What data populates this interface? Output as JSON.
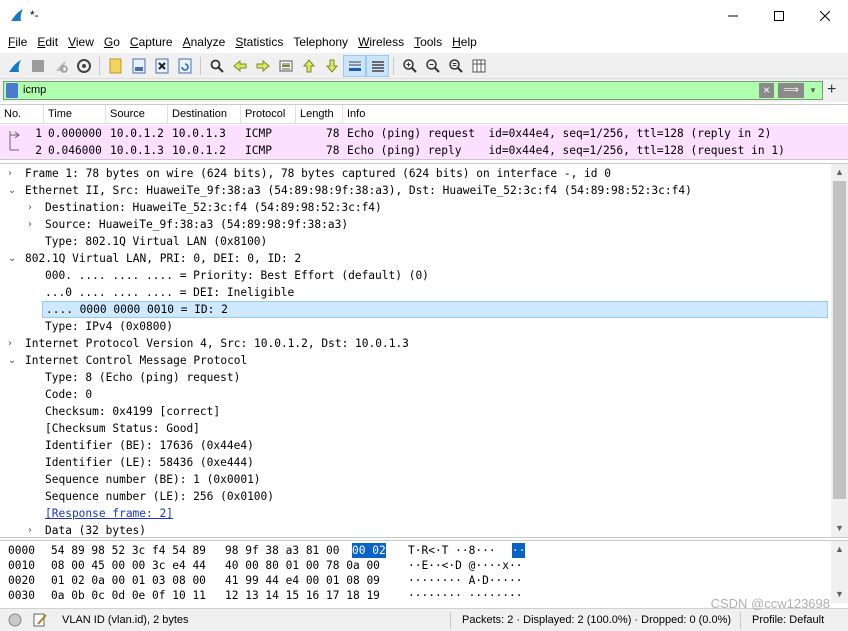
{
  "window": {
    "title": "*-",
    "minimize_glyph": "—",
    "maximize_glyph": "☐",
    "close_glyph": "✕"
  },
  "menu": {
    "items": [
      {
        "first": "F",
        "rest": "ile"
      },
      {
        "first": "E",
        "rest": "dit"
      },
      {
        "first": "V",
        "rest": "iew"
      },
      {
        "first": "G",
        "rest": "o"
      },
      {
        "first": "C",
        "rest": "apture"
      },
      {
        "first": "A",
        "rest": "nalyze"
      },
      {
        "first": "S",
        "rest": "tatistics"
      },
      {
        "first": "",
        "rest": "Telephony"
      },
      {
        "first": "W",
        "rest": "ireless"
      },
      {
        "first": "T",
        "rest": "ools"
      },
      {
        "first": "H",
        "rest": "elp"
      }
    ]
  },
  "toolbar": {
    "icons": [
      "shark-fin-start-icon",
      "stop-icon",
      "restart-icon",
      "options-gear-icon",
      "open-file-icon",
      "save-file-icon",
      "close-file-icon",
      "reload-icon",
      "find-icon",
      "go-back-icon",
      "go-forward-icon",
      "go-to-packet-icon",
      "go-first-icon",
      "go-last-icon",
      "autoscroll-icon",
      "colorize-icon",
      "zoom-in-icon",
      "zoom-out-icon",
      "zoom-normal-icon",
      "resize-columns-icon"
    ]
  },
  "filter": {
    "value": "icmp",
    "apply_glyph": "⟹",
    "dropdown_glyph": "▾",
    "add_glyph": "+"
  },
  "packet_list": {
    "columns": [
      "No.",
      "Time",
      "Source",
      "Destination",
      "Protocol",
      "Length",
      "Info"
    ],
    "rows": [
      {
        "no": "1",
        "time": "0.000000",
        "src": "10.0.1.2",
        "dst": "10.0.1.3",
        "proto": "ICMP",
        "len": "78",
        "info": "Echo (ping) request  id=0x44e4, seq=1/256, ttl=128 (reply in 2)"
      },
      {
        "no": "2",
        "time": "0.046000",
        "src": "10.0.1.3",
        "dst": "10.0.1.2",
        "proto": "ICMP",
        "len": "78",
        "info": "Echo (ping) reply    id=0x44e4, seq=1/256, ttl=128 (request in 1)"
      }
    ],
    "row_bg": "#fce0ff"
  },
  "details": {
    "lines": [
      {
        "arrow": "›",
        "text": "Frame 1: 78 bytes on wire (624 bits), 78 bytes captured (624 bits) on interface -, id 0"
      },
      {
        "arrow": "⌄",
        "text": "Ethernet II, Src: HuaweiTe_9f:38:a3 (54:89:98:9f:38:a3), Dst: HuaweiTe_52:3c:f4 (54:89:98:52:3c:f4)"
      },
      {
        "arrow": "›",
        "text": "Destination: HuaweiTe_52:3c:f4 (54:89:98:52:3c:f4)"
      },
      {
        "arrow": "›",
        "text": "Source: HuaweiTe_9f:38:a3 (54:89:98:9f:38:a3)"
      },
      {
        "arrow": "",
        "text": "Type: 802.1Q Virtual LAN (0x8100)"
      },
      {
        "arrow": "⌄",
        "text": "802.1Q Virtual LAN, PRI: 0, DEI: 0, ID: 2"
      },
      {
        "arrow": "",
        "text": "000. .... .... .... = Priority: Best Effort (default) (0)"
      },
      {
        "arrow": "",
        "text": "...0 .... .... .... = DEI: Ineligible"
      },
      {
        "arrow": "",
        "text": ".... 0000 0000 0010 = ID: 2"
      },
      {
        "arrow": "",
        "text": "Type: IPv4 (0x0800)"
      },
      {
        "arrow": "›",
        "text": "Internet Protocol Version 4, Src: 10.0.1.2, Dst: 10.0.1.3"
      },
      {
        "arrow": "⌄",
        "text": "Internet Control Message Protocol"
      },
      {
        "arrow": "",
        "text": "Type: 8 (Echo (ping) request)"
      },
      {
        "arrow": "",
        "text": "Code: 0"
      },
      {
        "arrow": "",
        "text": "Checksum: 0x4199 [correct]"
      },
      {
        "arrow": "",
        "text": "[Checksum Status: Good]"
      },
      {
        "arrow": "",
        "text": "Identifier (BE): 17636 (0x44e4)"
      },
      {
        "arrow": "",
        "text": "Identifier (LE): 58436 (0xe444)"
      },
      {
        "arrow": "",
        "text": "Sequence number (BE): 1 (0x0001)"
      },
      {
        "arrow": "",
        "text": "Sequence number (LE): 256 (0x0100)"
      },
      {
        "arrow": "",
        "text": "[Response frame: 2]"
      },
      {
        "arrow": "›",
        "text": "Data (32 bytes)"
      }
    ]
  },
  "hex": {
    "rows": [
      {
        "offset": "0000",
        "bytes_a": "54 89 98 52 3c f4 54 89",
        "bytes_b": "98 9f 38 a3 81 00",
        "bytes_hl": "00 02",
        "ascii": "T·R<·T ··8···",
        "ascii_hl": "··"
      },
      {
        "offset": "0010",
        "bytes_a": "08 00 45 00 00 3c e4 44",
        "bytes_b": "40 00 80 01 00 78 0a 00",
        "bytes_hl": "",
        "ascii": "··E··<·D @····x··",
        "ascii_hl": ""
      },
      {
        "offset": "0020",
        "bytes_a": "01 02 0a 00 01 03 08 00",
        "bytes_b": "41 99 44 e4 00 01 08 09",
        "bytes_hl": "",
        "ascii": "········ A·D·····",
        "ascii_hl": ""
      },
      {
        "offset": "0030",
        "bytes_a": "0a 0b 0c 0d 0e 0f 10 11",
        "bytes_b": "12 13 14 15 16 17 18 19",
        "bytes_hl": "",
        "ascii": "········ ········",
        "ascii_hl": ""
      }
    ]
  },
  "status": {
    "field": "VLAN ID (vlan.id), 2 bytes",
    "packets": "Packets: 2 · Displayed: 2 (100.0%) · Dropped: 0 (0.0%)",
    "profile": "Profile: Default"
  },
  "watermark": "CSDN @ccw123698",
  "colors": {
    "filter_bg": "#afffaf",
    "selected_bg": "#cde8ff",
    "hex_highlight": "#0a64c8",
    "link": "#1a34c8"
  }
}
